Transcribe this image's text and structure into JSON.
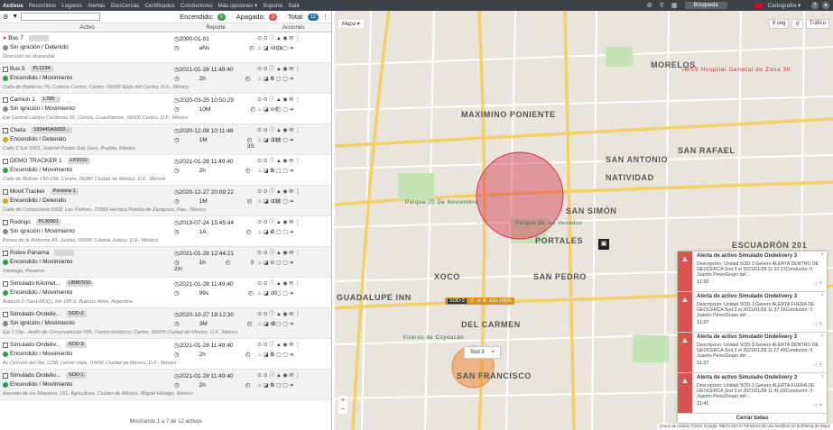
{
  "nav": {
    "items": [
      "Activos",
      "Recorridos",
      "Lugares",
      "Alertas",
      "GeoCercas",
      "Certificados",
      "Conductores",
      "Más opciones ▾",
      "Soporte",
      "Salir"
    ],
    "search_label": "Búsqueda",
    "cartography_label": "Cartografía ▾"
  },
  "panel": {
    "encendido_label": "Encendido:",
    "encendido_count": "6",
    "apagado_label": "Apagado:",
    "apagado_count": "3",
    "total_label": "Total:",
    "total_count": "12",
    "col_activo": "Activo",
    "col_reporte": "Reporte",
    "col_acciones": "Acciones",
    "footer": "Mostrando 1 a 7 de 12 activos"
  },
  "assets": [
    {
      "name": "Bus 7",
      "plate": "",
      "status": "Sin ignición / Detenido",
      "status_color": "#888888",
      "date": "2000-01-01",
      "r1": "aNs",
      "r2": "n/a",
      "address": "Dirección no disponible",
      "alert": true
    },
    {
      "name": "Bus 5",
      "plate": "PL1234",
      "status": "Encendido / Movimiento",
      "status_color": "#2e9e4a",
      "date": "2021-01-28 11:49:40",
      "r1": "2h",
      "r2": "0",
      "address": "Calle de Balderas 76, Colonia Centro, Centro, 06000 Ejido del Centro, D.F., México"
    },
    {
      "name": "Camion 1",
      "plate": "L789",
      "status": "Sin ignición / Movimiento",
      "status_color": "#888888",
      "date": "2020-03-25 10:50:29",
      "r1": "10M",
      "r2": "0",
      "address": "Eje Central Lázaro Cárdenas 55, Centro, Cuauhtémoc, 06000 Centro, D.F., México"
    },
    {
      "name": "Cheta",
      "plate": "193440A905D...",
      "status": "Encendido / Detenido",
      "status_color": "#e0a020",
      "date": "2020-12-08 10:11:48",
      "r1": "1M",
      "r2": "1M 3S",
      "address": "Calle 2 Sur 5301, Gabriel Pastor 2da Secc, Puebla, México"
    },
    {
      "name": "DEMO TRACKER 1",
      "plate": "LP2010",
      "status": "Encendido / Movimiento",
      "status_color": "#2e9e4a",
      "date": "2021-01-28 11:49:40",
      "r1": "2h",
      "r2": "0",
      "address": "Calle de Bolívar 150-158, Centro, 06080 Ciudad de México, D.F., México"
    },
    {
      "name": "Movil Tracker",
      "plate": "Persona 1",
      "status": "Encendido / Detenido",
      "status_color": "#e0a020",
      "date": "2020-12-27 20:09:22",
      "r1": "1M",
      "r2": "1M",
      "address": "Calle de Compostela 5302, Las Palmas, 72550 Heroica Puebla de Zaragoza, Pue., México"
    },
    {
      "name": "Rodrigo",
      "plate": "PL30901",
      "status": "Sin ignición / Movimiento",
      "status_color": "#888888",
      "date": "2019-07-24 15:45:44",
      "r1": "1A",
      "r2": "0",
      "address": "Paseo de la Reforma 84, Juárez, 06600 Colonia Juárez, D.F., México"
    },
    {
      "name": "Ruteo Panama",
      "plate": "",
      "status": "Encendido / Movimiento",
      "status_color": "#2e9e4a",
      "date": "2021-01-28 12:44:21",
      "r1": "1h 2m",
      "r2": "0",
      "address": "Santiago, Panamá"
    },
    {
      "name": "Simulado Kilomet...",
      "plate": "UBM7010",
      "status": "Encendido / Movimiento",
      "status_color": "#2e9e4a",
      "date": "2021-01-28 11:49:40",
      "r1": "99s",
      "r2": "0",
      "address": "Autovía 2 (Sest-MDQ), km 185.5, Buenos Aires, Argentina"
    },
    {
      "name": "Simulado Ondeliv...",
      "plate": "SOD-2",
      "status": "Sin ignición / Movimiento",
      "status_color": "#888888",
      "date": "2020-10-27 18:12:30",
      "r1": "3M",
      "r2": "0",
      "address": "Eje 1 Ote - Anillo de Circunvalación 505, Centro Histórico, Centro, 06000 Ciudad de México, D.F., México"
    },
    {
      "name": "Simulado Ondeliv...",
      "plate": "SOD-3",
      "status": "Encendido / Movimiento",
      "status_color": "#2e9e4a",
      "date": "2021-01-28 11:49:40",
      "r1": "2h",
      "r2": "0",
      "address": "Av División del Nte 1238, Letran Valle, 03650 Ciudad de México, D.F., México"
    },
    {
      "name": "Simulado Ondeliv...",
      "plate": "SOD-1",
      "status": "Encendido / Movimiento",
      "status_color": "#2e9e4a",
      "date": "2021-01-28 11:49:40",
      "r1": "2h",
      "r2": "0",
      "address": "Avenida de los Maestros 191, Agricultura, Ciudad de México, Miguel Hidalgo, México"
    }
  ],
  "map": {
    "type_label": "Mapa ▾",
    "refresh_label": "8 seg",
    "traffic_label": "Tráfico",
    "labels": {
      "morelos": "MORELOS",
      "mpoente": "MAXIMINO PONIENTE",
      "natividad": "NATIVIDAD",
      "sanrafael": "SAN RAFAEL",
      "sanantonio": "SAN ANTONIO",
      "santosimon": "SAN SIMÓN",
      "portales": "PORTALES",
      "escuadron": "ESCUADRÓN 201",
      "xoco": "XOCO",
      "sanpedro": "SAN PEDRO",
      "guadalupe": "GUADALUPE INN",
      "delcarmen": "DEL CARMEN",
      "sanfrancisco": "SAN FRANCISCO",
      "imss": "IMSS Hospital General de Zona 30",
      "parque20": "Parque 20 De Noviembre",
      "venados": "Parque de los Venados",
      "viveros": "Viveros de Coyoacán"
    },
    "tooltip": "Sod 3",
    "vehicle_label": "SOD-3",
    "vehicle_stats": "12v   100%",
    "footer": "Datos de mapas ©2021 Google, INEGI   500 m   Términos de uso   Notificar un problema de Maps"
  },
  "alerts": {
    "items": [
      {
        "title": "Alerta de activo Simulado Ondelivery 3",
        "desc": "Descripcion: Unidad SOD-3 Genero ALERTA DENTRO DE GEOCERCA Sod 3 el 2021/01/28 11:32:21Conductor: 0 Juanito PerezGrupo del ...",
        "time": "11:32"
      },
      {
        "title": "Alerta de activo Simulado Ondelivery 3",
        "desc": "Descripcion: Unidad SOD-3 Genero ALERTA FUERA DE GEOCERCA Sod 3 el 2021/01/28 11:37:16Conductor: 0 Juanito PerezGrupo del ...",
        "time": "11:37"
      },
      {
        "title": "Alerta de activo Simulado Ondelivery 3",
        "desc": "Descripcion: Unidad SOD-3 Genero ALERTA DENTRO DE GEOCERCA Sod 3 el 2021/01/28 11:27:45Conductor: 0 Juanito PerezGrupo del ...",
        "time": "11:27"
      },
      {
        "title": "Alerta de activo Simulado Ondelivery 3",
        "desc": "Descripcion: Unidad SOD-3 Genero ALERTA FUERA DE GEOCERCA Sod 3 el 2021/01/28 11:41:03Conductor: 0 Juanito PerezGrupo del ...",
        "time": "11:41"
      }
    ],
    "close_all": "Cerrar todas"
  },
  "colors": {
    "topbar": "#3b4148",
    "green": "#3c9b45",
    "red": "#d9534f",
    "blue": "#2e6da4",
    "geofence_red": "#d6324f",
    "geofence_orange": "#ef8a3c"
  }
}
